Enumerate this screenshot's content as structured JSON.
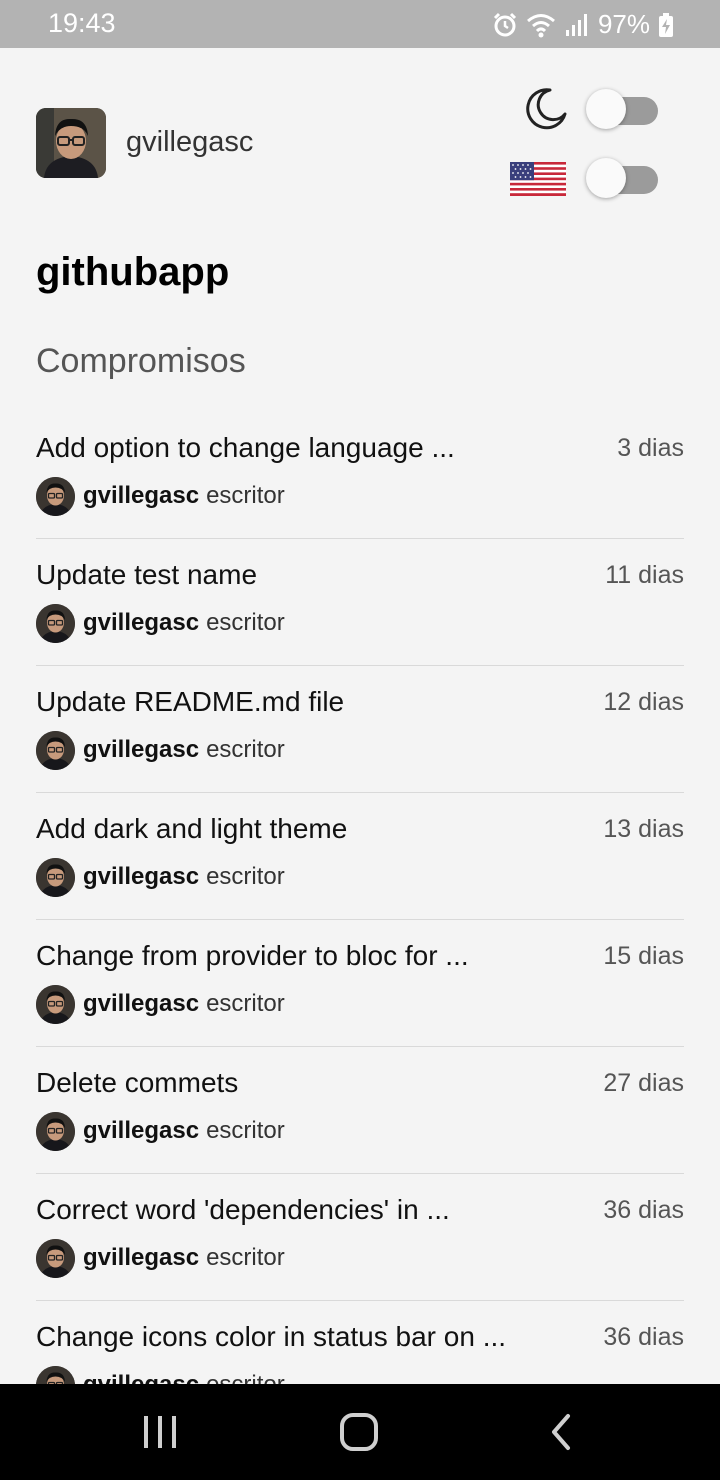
{
  "status_bar": {
    "time": "19:43",
    "battery": "97%"
  },
  "header": {
    "username": "gvillegasc"
  },
  "repo": {
    "name": "githubapp"
  },
  "section": {
    "title": "Compromisos"
  },
  "commits": [
    {
      "message": "Add option to change language ...",
      "time": "3 dias",
      "author": "gvillegasc",
      "role": "escritor"
    },
    {
      "message": "Update test name",
      "time": "11 dias",
      "author": "gvillegasc",
      "role": "escritor"
    },
    {
      "message": "Update README.md file",
      "time": "12 dias",
      "author": "gvillegasc",
      "role": "escritor"
    },
    {
      "message": "Add dark and light theme",
      "time": "13 dias",
      "author": "gvillegasc",
      "role": "escritor"
    },
    {
      "message": "Change from provider to bloc for ...",
      "time": "15 dias",
      "author": "gvillegasc",
      "role": "escritor"
    },
    {
      "message": "Delete commets",
      "time": "27 dias",
      "author": "gvillegasc",
      "role": "escritor"
    },
    {
      "message": "Correct word 'dependencies' in ...",
      "time": "36 dias",
      "author": "gvillegasc",
      "role": "escritor"
    },
    {
      "message": "Change icons color in status bar on ...",
      "time": "36 dias",
      "author": "gvillegasc",
      "role": "escritor"
    }
  ],
  "toggles": {
    "dark_mode": false,
    "language_english": false
  },
  "icons": {
    "theme": "moon-icon",
    "language": "us-flag-icon",
    "nav_recents": "recents-icon",
    "nav_home": "home-icon",
    "nav_back": "back-icon"
  },
  "colors": {
    "status_bar": "#b3b3b3",
    "background": "#f4f4f4",
    "switch_track": "#9b9b9b"
  }
}
